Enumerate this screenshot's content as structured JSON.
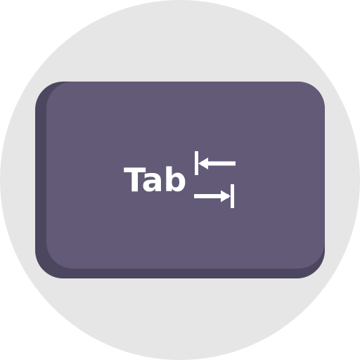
{
  "icon_name": "tab-key-icon",
  "colors": {
    "background_circle": "#e6e6e6",
    "key_face": "#625a77",
    "key_side": "#4d465f",
    "text": "#ffffff"
  },
  "key": {
    "label": "Tab"
  },
  "arrows": {
    "icon_name": "tab-arrows-icon",
    "top": "arrow-left-to-bar",
    "bottom": "arrow-right-to-bar"
  }
}
